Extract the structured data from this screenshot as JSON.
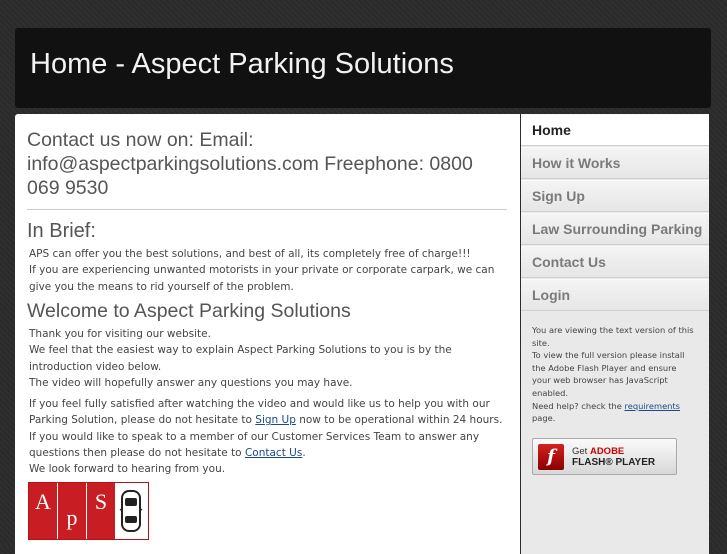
{
  "header": {
    "title": "Home - Aspect Parking Solutions"
  },
  "main": {
    "contact_heading": "Contact us now on: Email: info@aspectparkingsolutions.com Freephone: 0800 069 9530",
    "brief_heading": "In Brief:",
    "brief_line1": "APS can offer you the best solutions, and best of all, its completely free of charge!!!",
    "brief_line2": "If you are experiencing unwanted motorists in your private or corporate carpark, we can give you the means to rid yourself of the problem.",
    "welcome_heading": "Welcome to Aspect Parking Solutions",
    "welcome_line1": "Thank you for visiting our website.",
    "welcome_line2": "We feel that the easiest way to explain Aspect Parking Solutions to you is by the introduction video below.",
    "welcome_line3": "The video will hopefully answer any questions you may have.",
    "signup_pre": "If you feel fully satisfied after watching the video and would like us to help you with our Parking Solution, please do not hesitate to ",
    "signup_link": "Sign Up",
    "signup_post": " now to be operational within 24 hours.",
    "contact_pre": "If you would like to speak to a member of our Customer Services Team to answer any questions then please do not hesitate to ",
    "contact_link": "Contact Us",
    "contact_post": ".",
    "closing": "We look forward to hearing from you.",
    "logo_letters": [
      "A",
      "p",
      "S"
    ]
  },
  "sidebar": {
    "items": [
      {
        "label": "Home",
        "active": true
      },
      {
        "label": "How it Works",
        "active": false
      },
      {
        "label": "Sign Up",
        "active": false
      },
      {
        "label": "Law Surrounding Parking",
        "active": false
      },
      {
        "label": "Contact Us",
        "active": false
      },
      {
        "label": "Login",
        "active": false
      }
    ],
    "info_line1": "You are viewing the text version of this site.",
    "info_line2": "To view the full version please install the Adobe Flash Player and ensure your web browser has JavaScript enabled.",
    "info_help_pre": "Need help? check the ",
    "info_help_link": "requirements",
    "info_help_post": " page.",
    "flash_button": {
      "get": "Get",
      "adobe": "ADOBE",
      "player": "FLASH® PLAYER",
      "icon": "flash-icon"
    }
  },
  "colors": {
    "background": "#2a2a2a",
    "header": "#111111",
    "logo_red": "#c91d24",
    "link": "#1a4a8a"
  }
}
